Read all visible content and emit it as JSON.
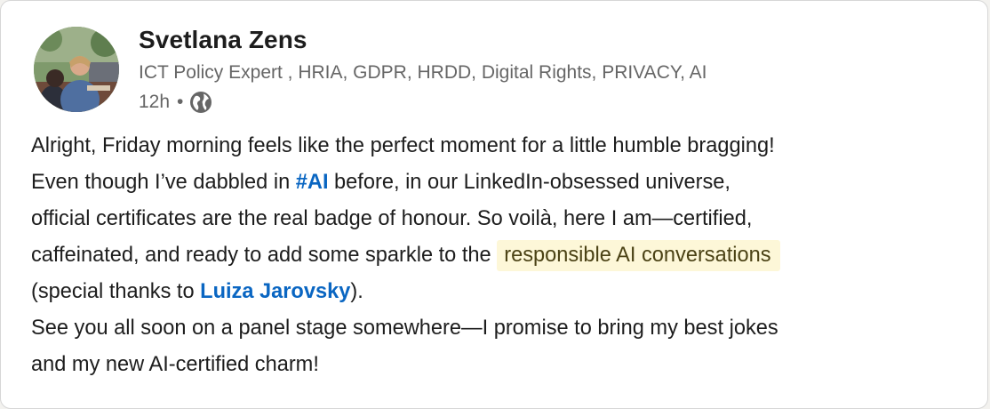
{
  "post": {
    "author": {
      "name": "Svetlana Zens",
      "headline": "ICT Policy Expert , HRIA, GDPR, HRDD, Digital Rights, PRIVACY, AI",
      "time": "12h",
      "separator": "•",
      "visibility_icon": "globe-icon"
    },
    "body": {
      "l1": "Alright, Friday morning feels like the perfect moment for a little humble bragging!",
      "l2_a": "Even though I’ve dabbled in ",
      "l2_hashtag": "#AI",
      "l2_b": " before, in our LinkedIn-obsessed universe,",
      "l3": "official certificates are the real badge of honour. So voilà, here I am—certified,",
      "l4_a": "caffeinated, and ready to add some sparkle to the ",
      "l4_highlight": "responsible AI conversations",
      "l5_a": "(special thanks to ",
      "l5_mention": "Luiza Jarovsky",
      "l5_b": ").",
      "l6": "See you all soon on a panel stage somewhere—I promise to bring my best jokes",
      "l7": "and my new AI-certified charm!"
    }
  },
  "colors": {
    "link": "#0a66c2",
    "highlight_bg": "#fdf7d8",
    "text": "#1d1d1d",
    "muted": "#666666"
  }
}
